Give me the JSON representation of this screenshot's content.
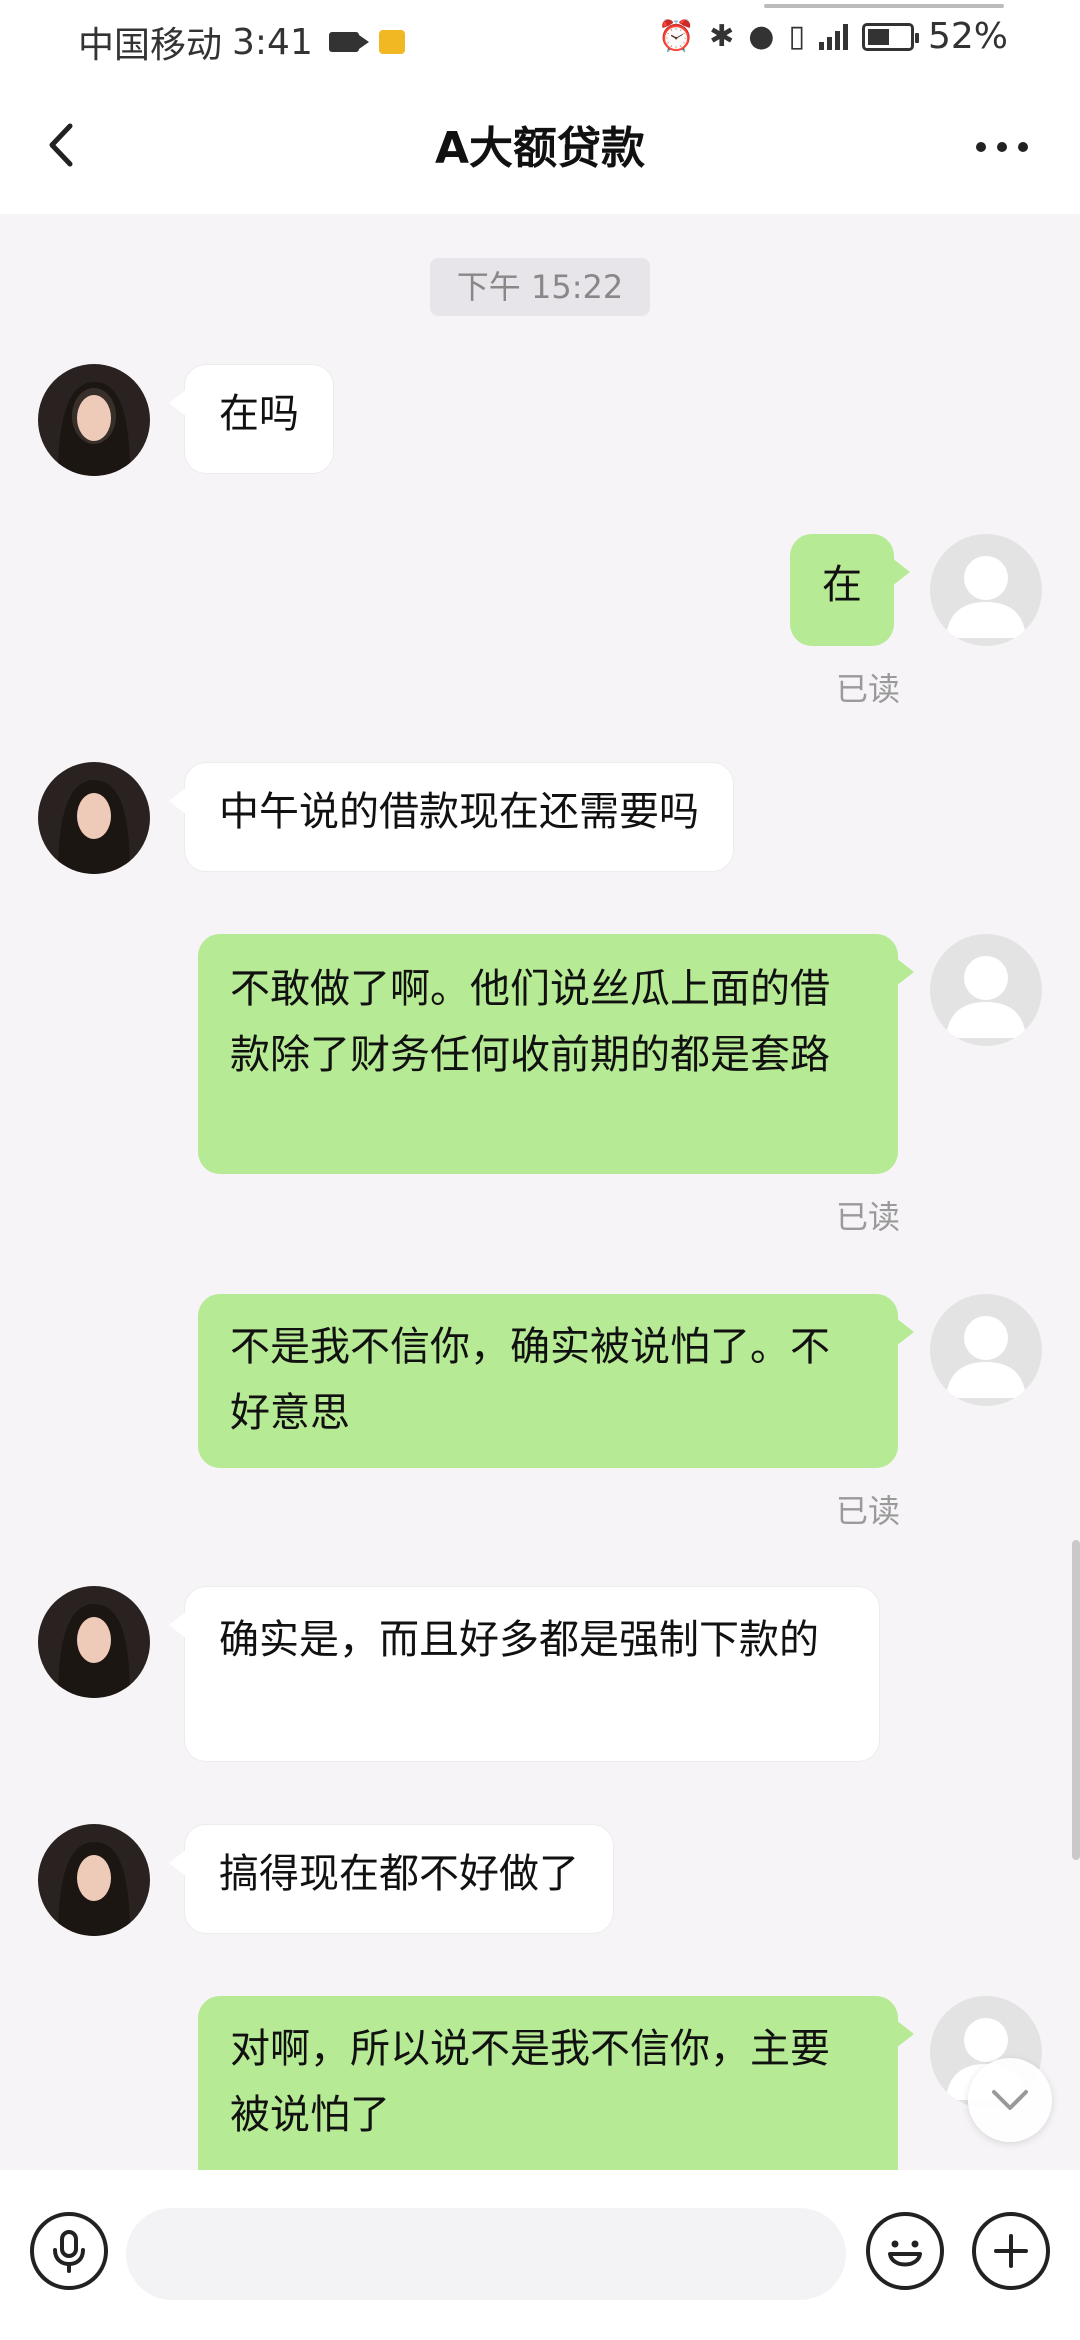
{
  "status_bar": {
    "carrier": "中国移动",
    "time": "3:41",
    "battery_percent": "52%",
    "battery_level": 0.52
  },
  "header": {
    "title": "A大额贷款",
    "back_icon": "chevron-left-icon",
    "more_icon": "more-dots-icon"
  },
  "chat": {
    "timestamp": "下午 15:22",
    "messages": [
      {
        "from": "contact",
        "text": "在吗"
      },
      {
        "from": "me",
        "text": "在",
        "status": "已读"
      },
      {
        "from": "contact",
        "text": "中午说的借款现在还需要吗"
      },
      {
        "from": "me",
        "text": "不敢做了啊。他们说丝瓜上面的借款除了财务任何收前期的都是套路",
        "status": "已读"
      },
      {
        "from": "me",
        "text": "不是我不信你，确实被说怕了。不好意思",
        "status": "已读"
      },
      {
        "from": "contact",
        "text": "确实是，而且好多都是强制下款的"
      },
      {
        "from": "contact",
        "text": "搞得现在都不好做了"
      },
      {
        "from": "me",
        "text": "对啊，所以说不是我不信你，主要被说怕了"
      }
    ]
  },
  "input_bar": {
    "placeholder": "",
    "voice_icon": "microphone-icon",
    "emoji_icon": "smiley-icon",
    "plus_icon": "plus-icon"
  },
  "colors": {
    "outgoing_bubble": "#b7ea94",
    "incoming_bubble": "#ffffff",
    "background": "#f6f4f7"
  }
}
